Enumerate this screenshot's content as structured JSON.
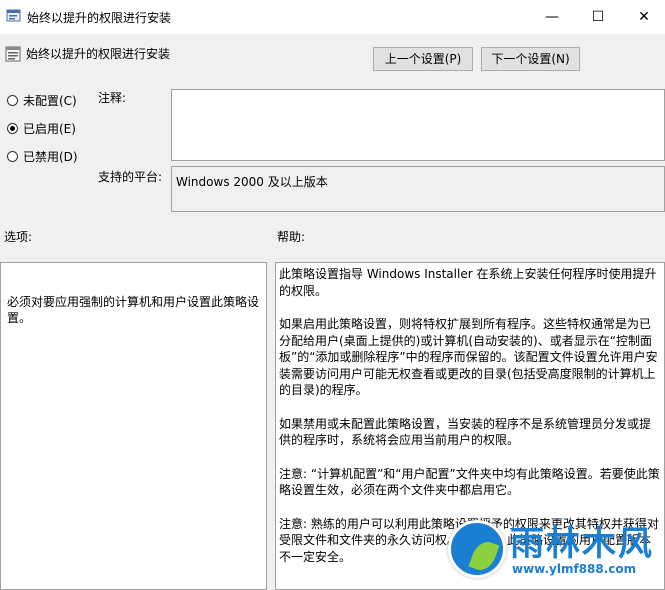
{
  "window": {
    "title": "始终以提升的权限进行安装",
    "minimize_glyph": "—",
    "maximize_glyph": "☐",
    "close_glyph": "✕"
  },
  "header": {
    "policy_name": "始终以提升的权限进行安装"
  },
  "nav": {
    "prev_label": "上一个设置(P)",
    "next_label": "下一个设置(N)"
  },
  "state": {
    "options": [
      {
        "label": "未配置(C)",
        "checked": false
      },
      {
        "label": "已启用(E)",
        "checked": true
      },
      {
        "label": "已禁用(D)",
        "checked": false
      }
    ]
  },
  "comment": {
    "label": "注释:",
    "value": ""
  },
  "platform": {
    "label": "支持的平台:",
    "value": "Windows 2000 及以上版本"
  },
  "options_section": {
    "label": "选项:",
    "text": "必须对要应用强制的计算机和用户设置此策略设置。"
  },
  "help_section": {
    "label": "帮助:",
    "paragraphs": [
      "此策略设置指导 Windows Installer 在系统上安装任何程序时使用提升的权限。",
      "如果启用此策略设置，则将特权扩展到所有程序。这些特权通常是为已分配给用户(桌面上提供的)或计算机(自动安装的)、或者显示在“控制面板”的“添加或删除程序”中的程序而保留的。该配置文件设置允许用户安装需要访问用户可能无权查看或更改的目录(包括受高度限制的计算机上的目录)的程序。",
      "如果禁用或未配置此策略设置，当安装的程序不是系统管理员分发或提供的程序时，系统将会应用当前用户的权限。",
      "注意: “计算机配置”和“用户配置”文件夹中均有此策略设置。若要使此策略设置生效，必须在两个文件夹中都启用它。",
      "注意: 熟练的用户可以利用此策略设置授予的权限来更改其特权并获得对受限文件和文件夹的永久访问权。请注意，此策略设置的用户配置版本不一定安全。"
    ]
  },
  "watermark": {
    "brand": "雨林木风",
    "url": "www.ylmf888.com",
    "color": "#1a7fd1"
  }
}
